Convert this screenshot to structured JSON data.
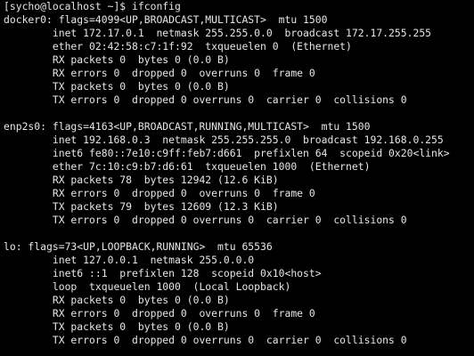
{
  "terminal": {
    "prompt": "[sycho@localhost ~]$ ",
    "command": "ifconfig",
    "interfaces": [
      {
        "header": "docker0: flags=4099<UP,BROADCAST,MULTICAST>  mtu 1500",
        "lines": [
          "        inet 172.17.0.1  netmask 255.255.0.0  broadcast 172.17.255.255",
          "        ether 02:42:58:c7:1f:92  txqueuelen 0  (Ethernet)",
          "        RX packets 0  bytes 0 (0.0 B)",
          "        RX errors 0  dropped 0  overruns 0  frame 0",
          "        TX packets 0  bytes 0 (0.0 B)",
          "        TX errors 0  dropped 0 overruns 0  carrier 0  collisions 0"
        ]
      },
      {
        "header": "enp2s0: flags=4163<UP,BROADCAST,RUNNING,MULTICAST>  mtu 1500",
        "lines": [
          "        inet 192.168.0.3  netmask 255.255.255.0  broadcast 192.168.0.255",
          "        inet6 fe80::7e10:c9ff:feb7:d661  prefixlen 64  scopeid 0x20<link>",
          "        ether 7c:10:c9:b7:d6:61  txqueuelen 1000  (Ethernet)",
          "        RX packets 78  bytes 12942 (12.6 KiB)",
          "        RX errors 0  dropped 0  overruns 0  frame 0",
          "        TX packets 79  bytes 12609 (12.3 KiB)",
          "        TX errors 0  dropped 0 overruns 0  carrier 0  collisions 0"
        ]
      },
      {
        "header": "lo: flags=73<UP,LOOPBACK,RUNNING>  mtu 65536",
        "lines": [
          "        inet 127.0.0.1  netmask 255.0.0.0",
          "        inet6 ::1  prefixlen 128  scopeid 0x10<host>",
          "        loop  txqueuelen 1000  (Local Loopback)",
          "        RX packets 0  bytes 0 (0.0 B)",
          "        RX errors 0  dropped 0  overruns 0  frame 0",
          "        TX packets 0  bytes 0 (0.0 B)",
          "        TX errors 0  dropped 0 overruns 0  carrier 0  collisions 0"
        ]
      }
    ]
  }
}
